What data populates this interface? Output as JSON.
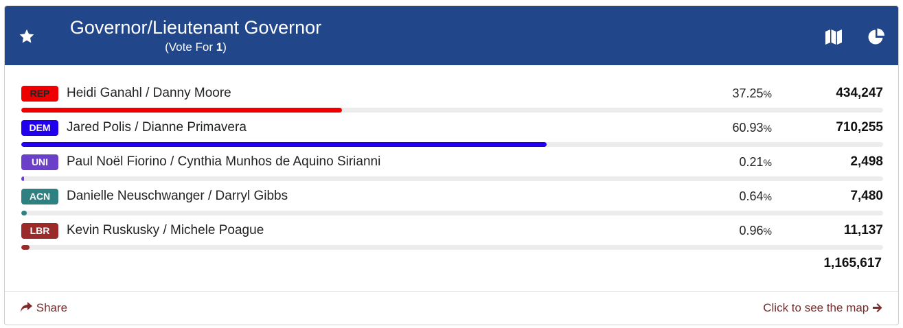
{
  "header": {
    "title": "Governor/Lieutenant Governor",
    "vote_for_prefix": "(Vote For ",
    "vote_for_count": "1",
    "vote_for_suffix": ")",
    "icons": [
      "star-icon",
      "map-icon",
      "pie-chart-icon"
    ],
    "background_color": "#22468a"
  },
  "candidates": [
    {
      "party": "REP",
      "name": "Heidi Ganahl / Danny Moore",
      "percent": "37.25",
      "percent_value": 37.25,
      "votes": "434,247",
      "color": "#ee0000",
      "badge_text_color": "#222222"
    },
    {
      "party": "DEM",
      "name": "Jared Polis / Dianne Primavera",
      "percent": "60.93",
      "percent_value": 60.93,
      "votes": "710,255",
      "color": "#2200ee",
      "badge_text_color": "#ffffff"
    },
    {
      "party": "UNI",
      "name": "Paul Noël Fiorino / Cynthia Munhos de Aquino Sirianni",
      "percent": "0.21",
      "percent_value": 0.21,
      "votes": "2,498",
      "color": "#6a3fc9",
      "badge_text_color": "#ffffff"
    },
    {
      "party": "ACN",
      "name": "Danielle Neuschwanger / Darryl Gibbs",
      "percent": "0.64",
      "percent_value": 0.64,
      "votes": "7,480",
      "color": "#2f8080",
      "badge_text_color": "#ffffff"
    },
    {
      "party": "LBR",
      "name": "Kevin Ruskusky / Michele Poague",
      "percent": "0.96",
      "percent_value": 0.96,
      "votes": "11,137",
      "color": "#9b2a2a",
      "badge_text_color": "#ffffff"
    }
  ],
  "percent_sign": "%",
  "total_votes": "1,165,617",
  "footer": {
    "share_label": "Share",
    "map_link_label": "Click to see the map",
    "icons": [
      "share-arrow-icon",
      "arrow-right-icon"
    ],
    "link_color": "#7d2a2a"
  }
}
